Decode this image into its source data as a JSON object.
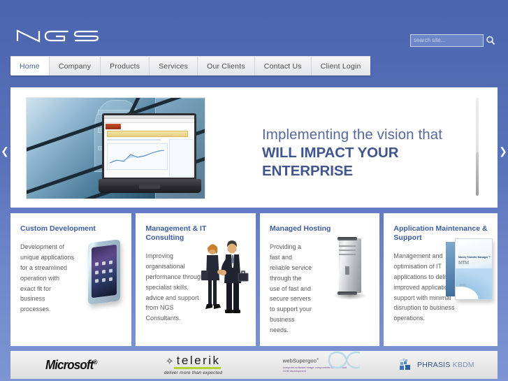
{
  "site": {
    "brand": "NGS",
    "accent_color": "#4a64ad",
    "nav_active_color": "#44619f"
  },
  "search": {
    "placeholder": "search site...",
    "value": "",
    "icon": "search-icon"
  },
  "nav": {
    "items": [
      {
        "label": "Home",
        "active": true
      },
      {
        "label": "Company",
        "active": false
      },
      {
        "label": "Products",
        "active": false
      },
      {
        "label": "Services",
        "active": false
      },
      {
        "label": "Our Clients",
        "active": false
      },
      {
        "label": "Contact Us",
        "active": false
      },
      {
        "label": "Client Login",
        "active": false
      }
    ]
  },
  "hero": {
    "line1": "Implementing the vision that",
    "line2": "WILL IMPACT YOUR ENTERPRISE",
    "prev_arrow": "❮",
    "next_arrow": "❯",
    "image_alt": "laptop-on-glass-building"
  },
  "cards": [
    {
      "title": "Custom Development",
      "body": "Development of unique applications for a streamlined operation with exact fit for business processes.",
      "art": "smartphone-image"
    },
    {
      "title": "Management & IT Consulting",
      "body": "Improving organisational performance through specialist skills, advice and support from NGS Consultants.",
      "art": "business-people-image"
    },
    {
      "title": "Managed Hosting",
      "body": "Providing a fast and reliable service through the use of fast and secure servers to support your business needs.",
      "art": "server-tower-image"
    },
    {
      "title": "Application Maintenance & Support",
      "body": "Management and optimisation of IT applications to deliver improved application support with minimal disruption to business operations.",
      "art": "software-box-image"
    }
  ],
  "partners": [
    {
      "name": "Microsoft",
      "trademark": "®"
    },
    {
      "name": "telerik",
      "tagline": "deliver more than expected"
    },
    {
      "name": "webSupergoo",
      "sub": "computer software image components for .NET and COM development"
    },
    {
      "name": "PHRASIS",
      "suffix": "KBDM"
    }
  ]
}
